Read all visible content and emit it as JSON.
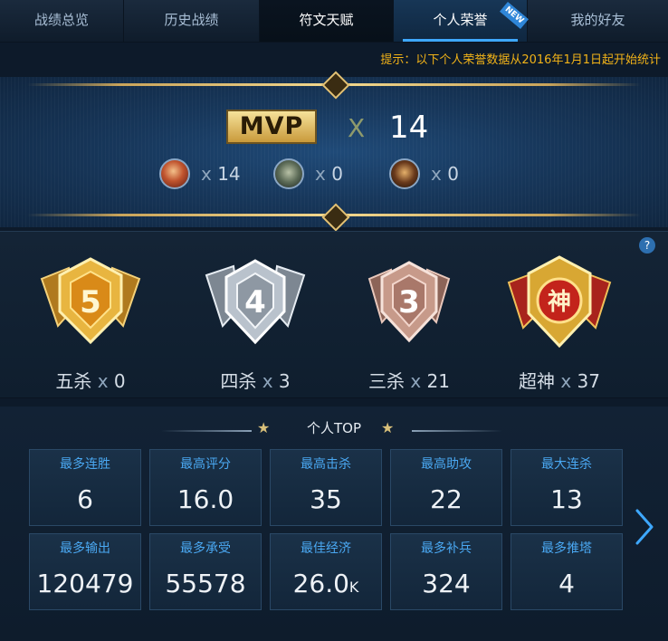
{
  "tabs": [
    {
      "label": "战绩总览"
    },
    {
      "label": "历史战绩"
    },
    {
      "label": "符文天赋"
    },
    {
      "label": "个人荣誉"
    },
    {
      "label": "我的好友"
    }
  ],
  "new_badge": "NEW",
  "hint": "提示：以下个人荣誉数据从2016年1月1日起开始统计",
  "mvp": {
    "badge": "MVP",
    "x": "X",
    "count": "14",
    "heroes": [
      {
        "icon": "hero-portrait-1",
        "x": "x",
        "count": "14"
      },
      {
        "icon": "hero-portrait-2",
        "x": "x",
        "count": "0"
      },
      {
        "icon": "hero-portrait-3",
        "x": "x",
        "count": "0"
      }
    ]
  },
  "help": "?",
  "medals": [
    {
      "name": "五杀",
      "x": "x",
      "count": "0",
      "glyph": "5",
      "color": "#e8b540"
    },
    {
      "name": "四杀",
      "x": "x",
      "count": "3",
      "glyph": "4",
      "color": "#b9c2cc"
    },
    {
      "name": "三杀",
      "x": "x",
      "count": "21",
      "glyph": "3",
      "color": "#c79a8a"
    },
    {
      "name": "超神",
      "x": "x",
      "count": "37",
      "glyph": "神",
      "color": "#d8a733"
    }
  ],
  "top": {
    "title": "个人TOP",
    "star": "★",
    "cells": [
      {
        "title": "最多连胜",
        "value": "6",
        "unit": ""
      },
      {
        "title": "最高评分",
        "value": "16.0",
        "unit": ""
      },
      {
        "title": "最高击杀",
        "value": "35",
        "unit": ""
      },
      {
        "title": "最高助攻",
        "value": "22",
        "unit": ""
      },
      {
        "title": "最大连杀",
        "value": "13",
        "unit": ""
      },
      {
        "title": "最多输出",
        "value": "120479",
        "unit": ""
      },
      {
        "title": "最多承受",
        "value": "55578",
        "unit": ""
      },
      {
        "title": "最佳经济",
        "value": "26.0",
        "unit": "K"
      },
      {
        "title": "最多补兵",
        "value": "324",
        "unit": ""
      },
      {
        "title": "最多推塔",
        "value": "4",
        "unit": ""
      }
    ]
  },
  "colors": {
    "accent": "#3ea8ff",
    "hint": "#f2b318",
    "cell_title": "#4aa8f2",
    "gold": "#e3c275"
  }
}
